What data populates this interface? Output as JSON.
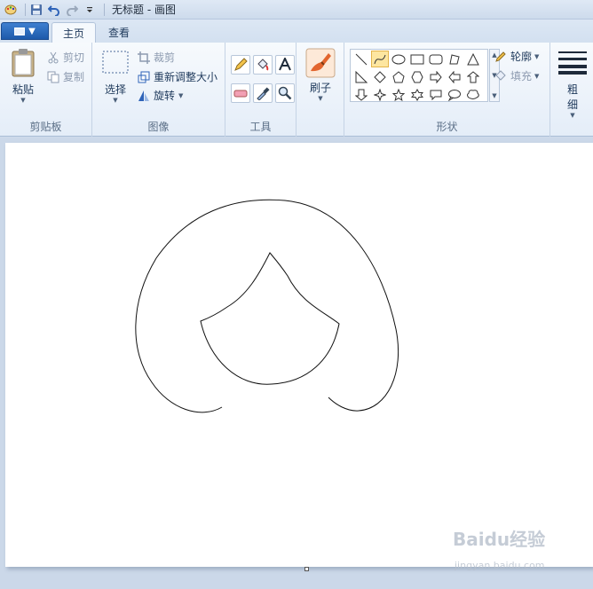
{
  "window": {
    "title": "无标题 - 画图"
  },
  "tabs": [
    {
      "label": "主页",
      "active": true
    },
    {
      "label": "查看",
      "active": false
    }
  ],
  "clipboard": {
    "group_label": "剪贴板",
    "paste_label": "粘贴",
    "cut_label": "剪切",
    "copy_label": "复制"
  },
  "image": {
    "group_label": "图像",
    "select_label": "选择",
    "crop_label": "裁剪",
    "resize_label": "重新调整大小",
    "rotate_label": "旋转"
  },
  "tools": {
    "group_label": "工具"
  },
  "brushes": {
    "label": "刷子"
  },
  "shapes": {
    "group_label": "形状",
    "outline_label": "轮廓",
    "fill_label": "填充"
  },
  "size": {
    "label_line1": "粗",
    "label_line2": "细"
  },
  "watermark": {
    "text": "Baidu经验",
    "sub": "jingyan.baidu.com"
  },
  "colors": {
    "accent": "#1d5aab",
    "selected_shape": "#fde6a0"
  }
}
